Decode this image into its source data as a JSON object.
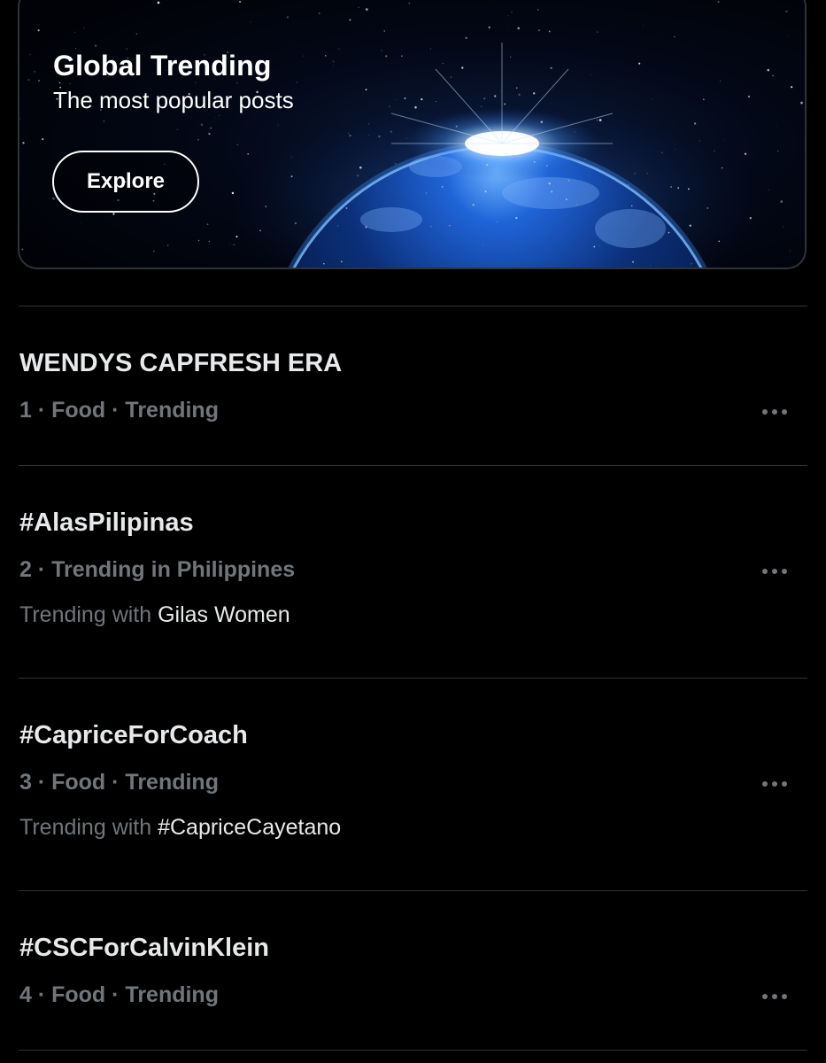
{
  "banner": {
    "title": "Global Trending",
    "subtitle": "The most popular posts",
    "button_label": "Explore",
    "image": "earth-from-space"
  },
  "trends": [
    {
      "name": "WENDYS CAPFRESH ERA",
      "meta": "1 · Food · Trending",
      "with_prefix": "",
      "with_term": ""
    },
    {
      "name": "#AlasPilipinas",
      "meta": "2 · Trending in Philippines",
      "with_prefix": "Trending with ",
      "with_term": "Gilas Women"
    },
    {
      "name": "#CapriceForCoach",
      "meta": "3 · Food · Trending",
      "with_prefix": "Trending with ",
      "with_term": "#CapriceCayetano"
    },
    {
      "name": "#CSCForCalvinKlein",
      "meta": "4 · Food · Trending",
      "with_prefix": "",
      "with_term": ""
    }
  ],
  "icons": {
    "more": "more-horizontal-icon"
  },
  "colors": {
    "background": "#000000",
    "primary_text": "#e7e9ea",
    "secondary_text": "#71767b",
    "divider": "#2f3336",
    "globe_glow": "#2a7bff"
  }
}
